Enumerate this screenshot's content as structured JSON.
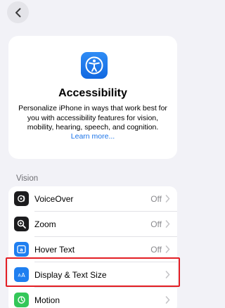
{
  "nav": {
    "back_icon": "chevron-left-icon"
  },
  "hero": {
    "icon": "accessibility-person-icon",
    "title": "Accessibility",
    "description": "Personalize iPhone in ways that work best for you with accessibility features for vision, mobility, hearing, speech, and cognition.",
    "link": "Learn more..."
  },
  "section": {
    "header": "Vision",
    "items": [
      {
        "label": "VoiceOver",
        "value": "Off",
        "icon": "voiceover-icon",
        "icon_color": "#1c1c1e"
      },
      {
        "label": "Zoom",
        "value": "Off",
        "icon": "zoom-magnifier-icon",
        "icon_color": "#1c1c1e"
      },
      {
        "label": "Hover Text",
        "value": "Off",
        "icon": "hover-text-icon",
        "icon_color": "#1f7ff0"
      },
      {
        "label": "Display & Text Size",
        "value": "",
        "icon": "text-size-icon",
        "icon_color": "#1f7ff0",
        "highlighted": true
      },
      {
        "label": "Motion",
        "value": "",
        "icon": "motion-icon",
        "icon_color": "#34c759"
      }
    ]
  },
  "colors": {
    "background": "#f2f2f7",
    "highlight_border": "#e31e24",
    "link": "#1a73e8"
  }
}
